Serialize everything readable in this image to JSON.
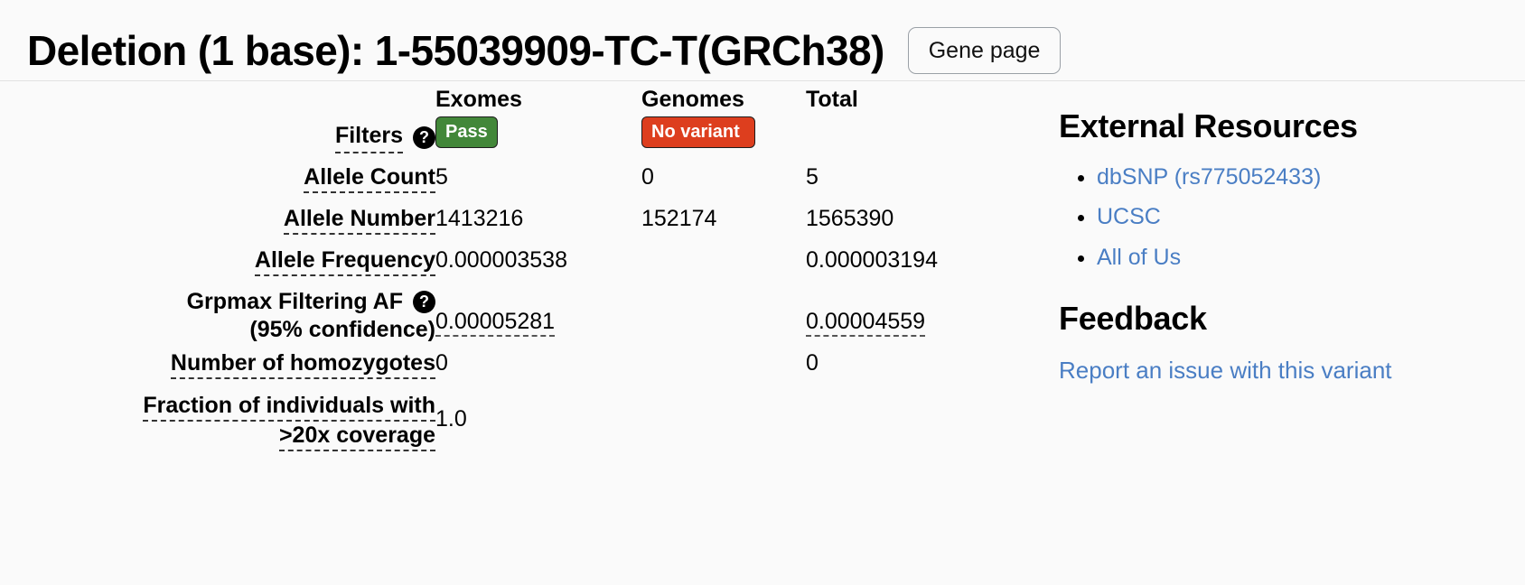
{
  "header": {
    "title": "Deletion (1 base): 1-55039909-TC-T(GRCh38)",
    "gene_page_button": "Gene page"
  },
  "variant_table": {
    "columns": [
      "",
      "Exomes",
      "Genomes",
      "Total"
    ],
    "rows": [
      {
        "label": "Filters",
        "has_help_icon": true,
        "help_glyph": "?",
        "label_dashed": true,
        "exomes": "Pass",
        "genomes": "No variant",
        "total": ""
      },
      {
        "label": "Allele Count",
        "label_dashed": true,
        "exomes": "5",
        "genomes": "0",
        "total": "5"
      },
      {
        "label": "Allele Number",
        "label_dashed": true,
        "exomes": "1413216",
        "genomes": "152174",
        "total": "1565390"
      },
      {
        "label": "Allele Frequency",
        "label_dashed": true,
        "exomes": "0.000003538",
        "genomes": "",
        "total": "0.000003194"
      },
      {
        "label_line1": "Grpmax Filtering AF",
        "label_line2": "(95% confidence)",
        "has_help_icon": true,
        "help_glyph": "?",
        "label_dashed": false,
        "exomes": "0.00005281",
        "genomes": "",
        "total": "0.00004559"
      },
      {
        "label": "Number of homozygotes",
        "label_dashed": true,
        "exomes": "0",
        "genomes": "",
        "total": "0"
      },
      {
        "label_line1": "Fraction of individuals with",
        "label_line2": ">20x coverage",
        "label_dashed": true,
        "exomes": "1.0",
        "genomes": "",
        "total": ""
      }
    ]
  },
  "badges": {
    "pass_label": "Pass",
    "pass_color": "#428739",
    "no_variant_label": "No variant",
    "no_variant_color": "#DD3E1E"
  },
  "external_resources": {
    "heading": "External Resources",
    "links": [
      {
        "label": "dbSNP (rs775052433)"
      },
      {
        "label": "UCSC"
      },
      {
        "label": "All of Us"
      }
    ]
  },
  "feedback": {
    "heading": "Feedback",
    "link_label": "Report an issue with this variant",
    "link_color": "#4a7ec4"
  }
}
